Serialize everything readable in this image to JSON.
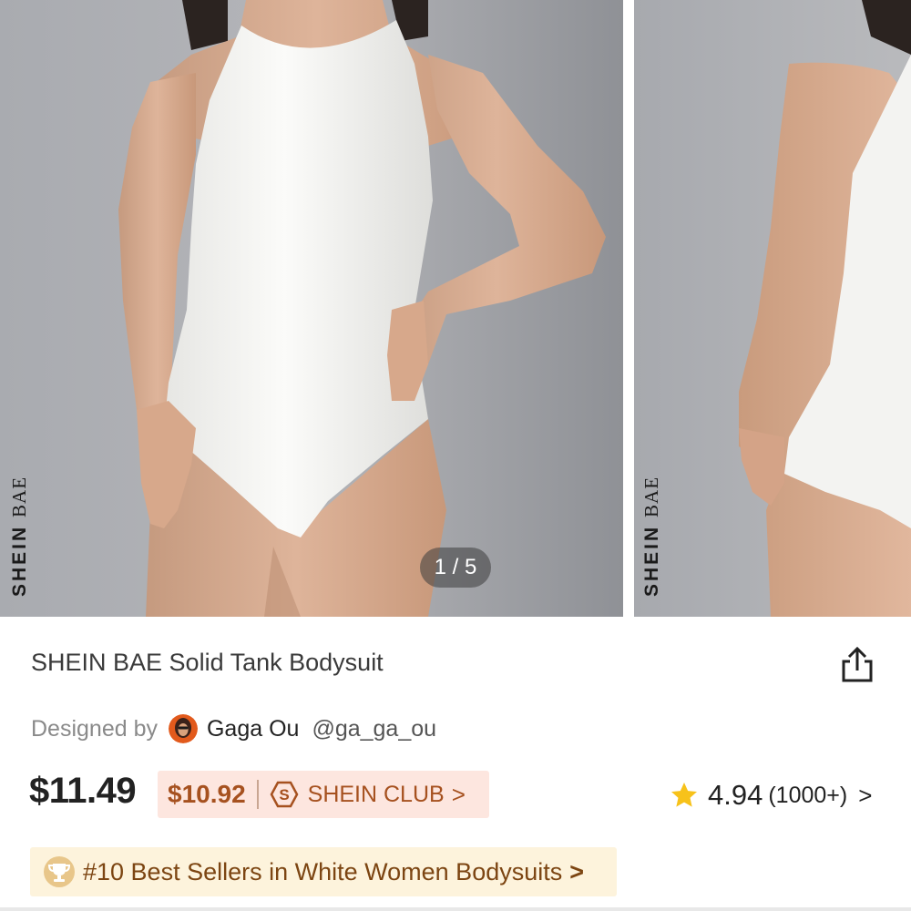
{
  "gallery": {
    "brand_mark_bold": "SHEIN",
    "brand_mark_light": "BAE",
    "counter": "1 / 5"
  },
  "product": {
    "title": "SHEIN BAE Solid Tank Bodysuit",
    "share_icon": "share-icon"
  },
  "designer": {
    "label": "Designed by",
    "name": "Gaga Ou",
    "handle": "@ga_ga_ou"
  },
  "pricing": {
    "price": "$11.49",
    "club_price": "$10.92",
    "club_name": "SHEIN CLUB",
    "club_arrow": ">"
  },
  "rating": {
    "score": "4.94",
    "count": "(1000+)",
    "arrow": ">"
  },
  "bestseller": {
    "text": "#10 Best Sellers in White Women Bodysuits",
    "arrow": ">"
  },
  "colors": {
    "club_bg": "#fde6df",
    "club_text": "#a6511f",
    "bestseller_bg": "#fdf3dc",
    "bestseller_text": "#7c4512",
    "star": "#f7c21a"
  }
}
